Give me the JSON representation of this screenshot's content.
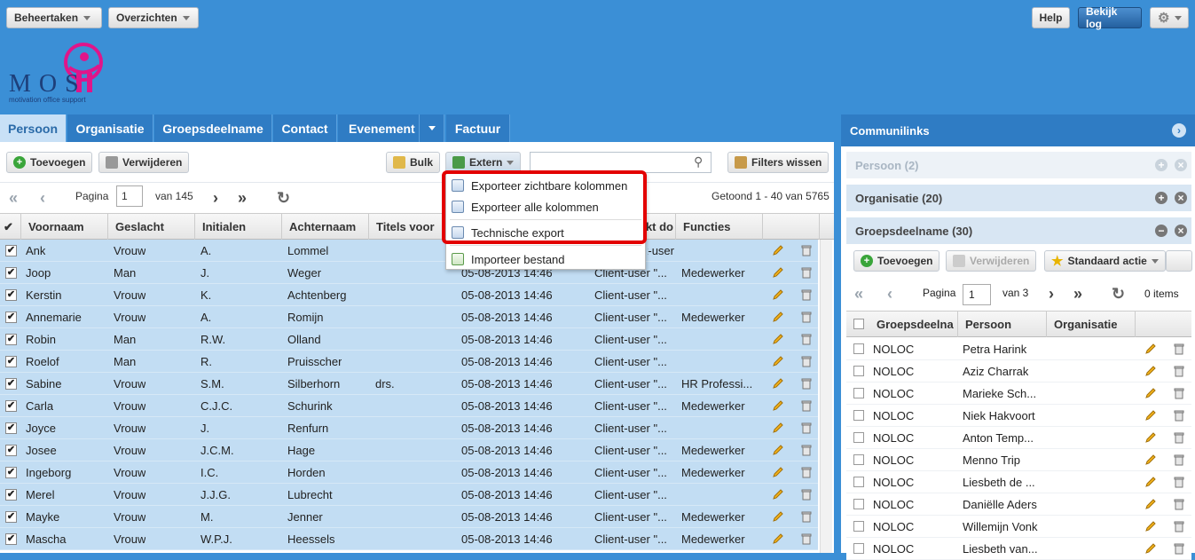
{
  "topbar": {
    "beheertaken": "Beheertaken",
    "overzichten": "Overzichten",
    "help": "Help",
    "bekijk_log": "Bekijk log"
  },
  "logo": {
    "brand": "MOS",
    "tagline": "motivation office support"
  },
  "tabs": [
    {
      "label": "Persoon",
      "active": true
    },
    {
      "label": "Organisatie"
    },
    {
      "label": "Groepsdeelname"
    },
    {
      "label": "Contact"
    },
    {
      "label": "Evenement"
    },
    {
      "label": "Factuur"
    }
  ],
  "toolbar": {
    "toevoegen": "Toevoegen",
    "verwijderen": "Verwijderen",
    "bulk": "Bulk",
    "extern": "Extern",
    "search_value": "",
    "filters_wissen": "Filters wissen"
  },
  "pager": {
    "pagina_label": "Pagina",
    "page": "1",
    "van": "van 145",
    "getoond": "Getoond 1 - 40 van 5765"
  },
  "columns": [
    "Voornaam",
    "Geslacht",
    "Initialen",
    "Achternaam",
    "Titels voor",
    "",
    "kt do",
    "Functies"
  ],
  "rows": [
    {
      "voornaam": "Ank",
      "geslacht": "Vrouw",
      "initialen": "A.",
      "achternaam": "Lommel",
      "titels": "",
      "datum": "",
      "user": "",
      "functies": ""
    },
    {
      "voornaam": "Joop",
      "geslacht": "Man",
      "initialen": "J.",
      "achternaam": "Weger",
      "titels": "",
      "datum": "05-08-2013 14:46",
      "user": "Client-user \"...",
      "functies": "Medewerker"
    },
    {
      "voornaam": "Kerstin",
      "geslacht": "Vrouw",
      "initialen": "K.",
      "achternaam": "Achtenberg",
      "titels": "",
      "datum": "05-08-2013 14:46",
      "user": "Client-user \"...",
      "functies": ""
    },
    {
      "voornaam": "Annemarie",
      "geslacht": "Vrouw",
      "initialen": "A.",
      "achternaam": "Romijn",
      "titels": "",
      "datum": "05-08-2013 14:46",
      "user": "Client-user \"...",
      "functies": "Medewerker"
    },
    {
      "voornaam": "Robin",
      "geslacht": "Man",
      "initialen": "R.W.",
      "achternaam": "Olland",
      "titels": "",
      "datum": "05-08-2013 14:46",
      "user": "Client-user \"...",
      "functies": ""
    },
    {
      "voornaam": "Roelof",
      "geslacht": "Man",
      "initialen": "R.",
      "achternaam": "Pruisscher",
      "titels": "",
      "datum": "05-08-2013 14:46",
      "user": "Client-user \"...",
      "functies": ""
    },
    {
      "voornaam": "Sabine",
      "geslacht": "Vrouw",
      "initialen": "S.M.",
      "achternaam": "Silberhorn",
      "titels": "drs.",
      "datum": "05-08-2013 14:46",
      "user": "Client-user \"...",
      "functies": "HR Professi..."
    },
    {
      "voornaam": "Carla",
      "geslacht": "Vrouw",
      "initialen": "C.J.C.",
      "achternaam": "Schurink",
      "titels": "",
      "datum": "05-08-2013 14:46",
      "user": "Client-user \"...",
      "functies": "Medewerker"
    },
    {
      "voornaam": "Joyce",
      "geslacht": "Vrouw",
      "initialen": "J.",
      "achternaam": "Renfurn",
      "titels": "",
      "datum": "05-08-2013 14:46",
      "user": "Client-user \"...",
      "functies": ""
    },
    {
      "voornaam": "Josee",
      "geslacht": "Vrouw",
      "initialen": "J.C.M.",
      "achternaam": "Hage",
      "titels": "",
      "datum": "05-08-2013 14:46",
      "user": "Client-user \"...",
      "functies": "Medewerker"
    },
    {
      "voornaam": "Ingeborg",
      "geslacht": "Vrouw",
      "initialen": "I.C.",
      "achternaam": "Horden",
      "titels": "",
      "datum": "05-08-2013 14:46",
      "user": "Client-user \"...",
      "functies": "Medewerker"
    },
    {
      "voornaam": "Merel",
      "geslacht": "Vrouw",
      "initialen": "J.J.G.",
      "achternaam": "Lubrecht",
      "titels": "",
      "datum": "05-08-2013 14:46",
      "user": "Client-user \"...",
      "functies": ""
    },
    {
      "voornaam": "Mayke",
      "geslacht": "Vrouw",
      "initialen": "M.",
      "achternaam": "Jenner",
      "titels": "",
      "datum": "05-08-2013 14:46",
      "user": "Client-user \"...",
      "functies": "Medewerker"
    },
    {
      "voornaam": "Mascha",
      "geslacht": "Vrouw",
      "initialen": "W.P.J.",
      "achternaam": "Heessels",
      "titels": "",
      "datum": "05-08-2013 14:46",
      "user": "Client-user \"...",
      "functies": "Medewerker"
    }
  ],
  "row0_user": "Client-user \"...",
  "menu": {
    "exporteer_zichtbaar": "Exporteer zichtbare kolommen",
    "exporteer_alle": "Exporteer alle kolommen",
    "technische_export": "Technische export",
    "importeer_bestand": "Importeer bestand"
  },
  "right": {
    "title": "Communilinks",
    "persoon": "Persoon (2)",
    "organisatie": "Organisatie (20)",
    "groepsdeelname": "Groepsdeelname (30)",
    "toevoegen": "Toevoegen",
    "verwijderen": "Verwijderen",
    "standaard_actie": "Standaard actie",
    "pagina_label": "Pagina",
    "page": "1",
    "van": "van 3",
    "items": "0 items",
    "columns": [
      "Groepsdeelna",
      "Persoon",
      "Organisatie"
    ],
    "rows": [
      {
        "groep": "NOLOC",
        "persoon": "Petra Harink"
      },
      {
        "groep": "NOLOC",
        "persoon": "Aziz Charrak"
      },
      {
        "groep": "NOLOC",
        "persoon": "Marieke Sch..."
      },
      {
        "groep": "NOLOC",
        "persoon": "Niek Hakvoort"
      },
      {
        "groep": "NOLOC",
        "persoon": "Anton Temp..."
      },
      {
        "groep": "NOLOC",
        "persoon": "Menno Trip"
      },
      {
        "groep": "NOLOC",
        "persoon": "Liesbeth de ..."
      },
      {
        "groep": "NOLOC",
        "persoon": "Daniëlle Aders"
      },
      {
        "groep": "NOLOC",
        "persoon": "Willemijn Vonk"
      },
      {
        "groep": "NOLOC",
        "persoon": "Liesbeth van..."
      }
    ]
  }
}
